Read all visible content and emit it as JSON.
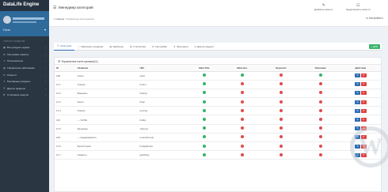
{
  "app": {
    "brand": "DataLife Engine",
    "profile_dropdown": "Гость"
  },
  "sidebar": {
    "section": "Список разделов",
    "items": [
      {
        "label": "Все разделы админ",
        "icon": "grid-icon"
      },
      {
        "label": "Настройки скрипта",
        "icon": "cog-icon"
      },
      {
        "label": "Пользователи",
        "icon": "users-icon"
      },
      {
        "label": "Управление шаблонами",
        "icon": "template-icon"
      },
      {
        "label": "Новости",
        "icon": "news-icon"
      },
      {
        "label": "Рекламные разделы",
        "icon": "ads-icon"
      },
      {
        "label": "Другие разделы",
        "icon": "sections-icon"
      },
      {
        "label": "Сторонние модули",
        "icon": "modules-icon"
      }
    ]
  },
  "header": {
    "title": "Менеджер категорий",
    "btn_add_news": "Добавить новость",
    "btn_edit_news": "Редактировать новости",
    "breadcrumb_home": "Главная",
    "breadcrumb_current": "Управление категориями",
    "settings": "Настройки"
  },
  "tabs": [
    {
      "label": "Категории",
      "icon": "list-icon",
      "active": true
    },
    {
      "label": "Массовое операции",
      "icon": "check-icon",
      "active": false
    },
    {
      "label": "Шаблоны",
      "icon": "file-icon",
      "active": false
    },
    {
      "label": "Статистика",
      "icon": "stats-icon",
      "active": false
    },
    {
      "label": "Настройки",
      "icon": "gear-icon",
      "active": false
    },
    {
      "label": "Экшонали",
      "icon": "star-icon",
      "active": false
    },
    {
      "label": "Другие модули",
      "icon": "plug-icon",
      "active": false
    }
  ],
  "add_button": "+ ДОБ",
  "panel_title": "Управление категориями(11)",
  "table": {
    "columns": [
      "ID",
      "Название",
      "URL",
      "Meta Title",
      "Meta Des.",
      "Keywords",
      "Описание",
      "Действия"
    ],
    "rows": [
      {
        "id": "128",
        "name": "Спорт",
        "url": "sport",
        "s": [
          1,
          1,
          0,
          1
        ]
      },
      {
        "id": "11.1",
        "name": "Туризм",
        "url": "turizm",
        "s": [
          1,
          0,
          0,
          0
        ]
      },
      {
        "id": "11.2",
        "name": "Финансы",
        "url": "finansy",
        "s": [
          1,
          0,
          0,
          0
        ]
      },
      {
        "id": "11.3",
        "name": "Книги",
        "url": "knigi",
        "s": [
          1,
          0,
          0,
          0
        ]
      },
      {
        "id": "11.4",
        "name": "Тюнинг",
        "url": "tyuning",
        "s": [
          1,
          0,
          0,
          0
        ]
      },
      {
        "id": "116",
        "name": "— Хобби",
        "url": "hobby",
        "s": [
          1,
          0,
          0,
          0
        ]
      },
      {
        "id": "11.5",
        "name": "Здоровье",
        "url": "zdorove",
        "s": [
          1,
          0,
          0,
          0
        ]
      },
      {
        "id": "106",
        "name": "— Недвижимость",
        "url": "nedvizhimost",
        "s": [
          1,
          0,
          0,
          0
        ]
      },
      {
        "id": "11.6",
        "name": "Бухгалтерия",
        "url": "buhgalteriya",
        "s": [
          1,
          0,
          0,
          0
        ]
      },
      {
        "id": "11.7",
        "name": "Гаджеты",
        "url": "gadzhety",
        "s": [
          1,
          0,
          0,
          0
        ]
      }
    ]
  },
  "colors": {
    "sidebar": "#2b3643",
    "accent": "#2e6a9a",
    "ok": "#36b26a",
    "no": "#e14b4b",
    "edit": "#2f6fb6",
    "delete": "#e0443f"
  }
}
